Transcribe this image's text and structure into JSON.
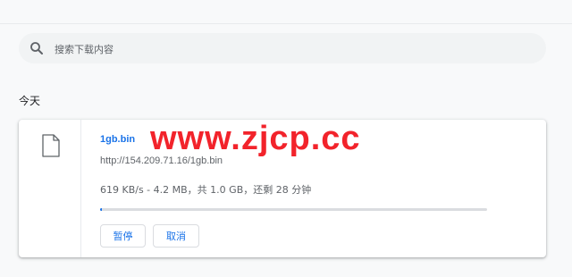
{
  "search": {
    "placeholder": "搜索下载内容",
    "icon": "search-icon"
  },
  "downloads": {
    "date_group": "今天",
    "items": [
      {
        "file_icon": "file-icon",
        "file_name": "1gb.bin",
        "url": "http://154.209.71.16/1gb.bin",
        "progress_text": "619 KB/s - 4.2 MB，共 1.0 GB，还剩 28 分钟",
        "progress_fraction": 0.0041,
        "buttons": {
          "pause": "暂停",
          "cancel": "取消"
        }
      }
    ]
  },
  "watermark": "www.zjcp.cc",
  "colors": {
    "accent": "#1a73e8",
    "watermark": "#f2232b",
    "track": "#dadce0"
  }
}
